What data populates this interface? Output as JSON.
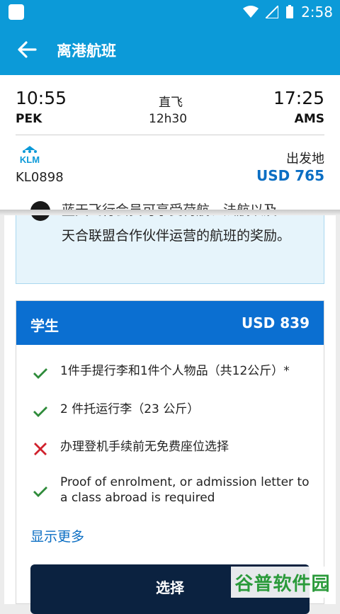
{
  "status_bar": {
    "time": "2:58"
  },
  "app_bar": {
    "title": "离港航班"
  },
  "flight": {
    "depart_time": "10:55",
    "depart_code": "PEK",
    "arrive_time": "17:25",
    "arrive_code": "AMS",
    "type": "直飞",
    "duration": "12h30",
    "airline_logo": "KLM",
    "flight_number": "KL0898",
    "price_label": "出发地",
    "price": "USD 765"
  },
  "info": {
    "partial_line": "蓝天飞行会员可享受荷航、法航以及",
    "text": "天合联盟合作伙伴运营的航班的奖励。"
  },
  "fare": {
    "name": "学生",
    "price": "USD 839",
    "features": [
      {
        "icon": "check-icon",
        "text": "1件手提行李和1件个人物品（共12公斤）*"
      },
      {
        "icon": "check-icon",
        "text": "2 件托运行李（23 公斤）"
      },
      {
        "icon": "cross-icon",
        "text": "办理登机手续前无免费座位选择"
      },
      {
        "icon": "check-icon",
        "text": "Proof of enrolment, or admission letter to a class abroad is required"
      }
    ],
    "show_more": "显示更多",
    "select": "选择"
  },
  "watermark": "谷普软件园",
  "colors": {
    "brand": "#0c9ad8",
    "fare_header": "#0b6fd1",
    "price": "#0b6ec3",
    "button": "#0b2240",
    "check": "#2e8b3a",
    "cross": "#d0212c"
  }
}
